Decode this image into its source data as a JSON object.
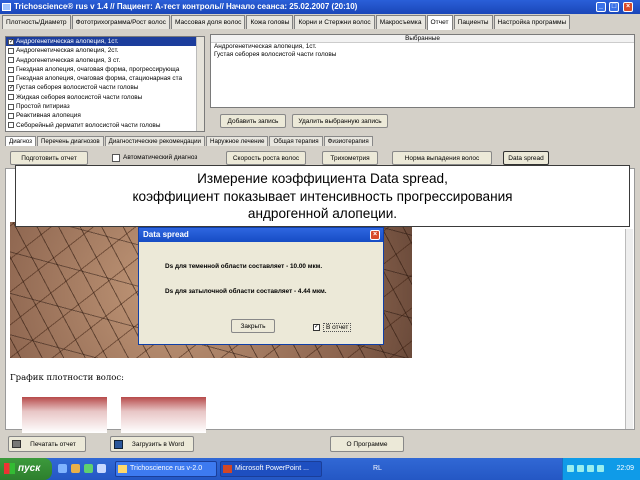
{
  "window": {
    "title": "Trichoscience® rus v 1.4 // Пациент:  A-тест контроль// Начало сеанса: 25.02.2007 (20:10)",
    "min": "_",
    "max": "□",
    "close": "×"
  },
  "top_tabs": [
    {
      "label": "Плотность/Диаметр"
    },
    {
      "label": "Фототрихограмма/Рост волос"
    },
    {
      "label": "Массовая доля волос"
    },
    {
      "label": "Кожа головы"
    },
    {
      "label": "Корни и Стержни волос"
    },
    {
      "label": "Макросъемка"
    },
    {
      "label": "Отчет",
      "active": true
    },
    {
      "label": "Пациенты"
    },
    {
      "label": "Настройка программы"
    }
  ],
  "diagnosis_list": [
    {
      "label": "Андрогенетическая алопеция, 1ст.",
      "checked": true,
      "selected": true
    },
    {
      "label": "Андрогенетическая алопеция, 2ст.",
      "checked": false
    },
    {
      "label": "Андрогенетическая алопеция, 3 ст.",
      "checked": false
    },
    {
      "label": "Гнездная алопеция, очаговая форма, прогрессирующа",
      "checked": false
    },
    {
      "label": "Гнездная алопеция, очаговая форма, стационарная ста",
      "checked": false
    },
    {
      "label": "Густая себорея волосистой части головы",
      "checked": true
    },
    {
      "label": "Жидкая себорея волосистой части головы",
      "checked": false
    },
    {
      "label": "Простой питириаз",
      "checked": false
    },
    {
      "label": "Реактивная алопеция",
      "checked": false
    },
    {
      "label": "Себорейный дерматит волосистой части головы",
      "checked": false
    }
  ],
  "selected_box": {
    "header": "Выбранные",
    "items": [
      "Андрогенетическая алопеция, 1ст.",
      "Густая себорея волосистой части головы"
    ]
  },
  "buttons": {
    "add": "Добавить запись",
    "remove": "Удалить выбранную запись"
  },
  "bottom_tabs": [
    {
      "label": "Диагноз",
      "active": true
    },
    {
      "label": "Перечень диагнозов"
    },
    {
      "label": "Диагностические рекомендации"
    },
    {
      "label": "Наружное лечение"
    },
    {
      "label": "Общая терапия"
    },
    {
      "label": "Физиотерапия"
    }
  ],
  "report_row": {
    "prepare": "Подготовить отчет",
    "auto_diag": "Автоматический диагноз",
    "growth": "Скорость роста волос",
    "trichometry": "Трихометрия",
    "norm": "Норма выпадения волос",
    "data_spread": "Data spread"
  },
  "caption": {
    "line1": "Измерение коэффициента Data spread,",
    "line2": "коэффициент показывает интенсивность прогрессирования",
    "line3": "андрогенной алопеции."
  },
  "dialog": {
    "title": "Data spread",
    "close": "×",
    "line1": "Ds для теменной области составляет - 10.00 мкм.",
    "line2": "Ds для затылочной области составляет - 4.44 мкм.",
    "button": "Закрыть",
    "checkbox_label": "В отчет",
    "checkbox_mark": "✓"
  },
  "density_label": "График плотности волос:",
  "bottom_bar": {
    "print": "Печатать отчет",
    "word": "Загрузить в Word",
    "about": "О Программе"
  },
  "taskbar": {
    "start": "пуск",
    "task1": "Trichoscience rus v-2.0",
    "task2": "Microsoft PowerPoint ...",
    "lang": "RL",
    "clock": "22:09"
  }
}
